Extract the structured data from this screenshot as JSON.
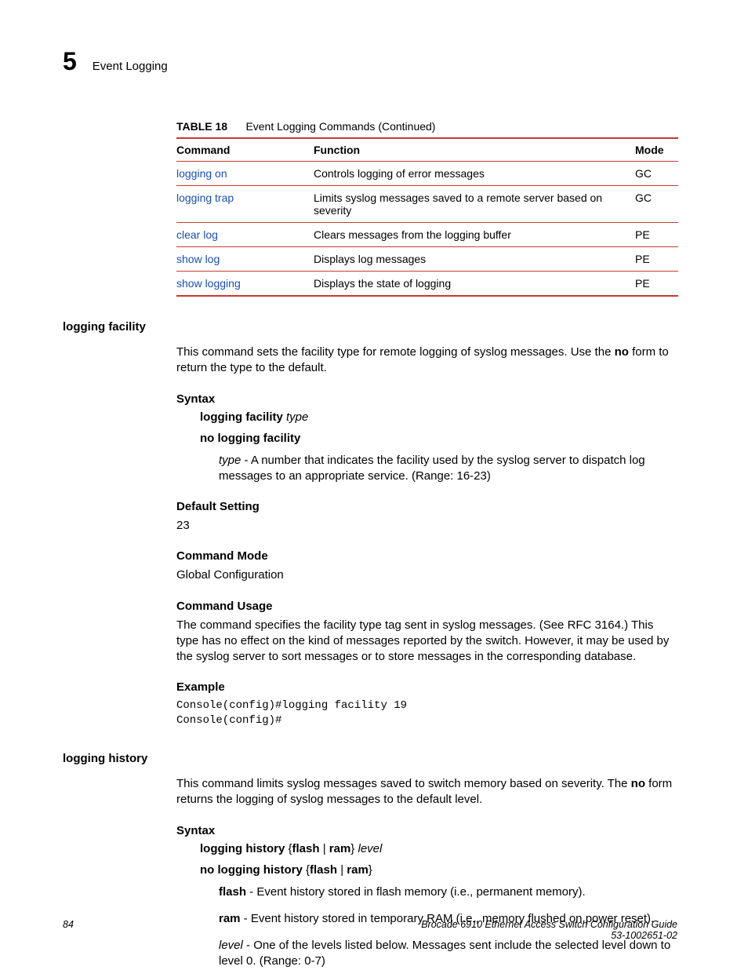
{
  "header": {
    "chapter_number": "5",
    "chapter_title": "Event Logging"
  },
  "table": {
    "label": "TABLE 18",
    "caption": "Event Logging Commands  (Continued)",
    "headers": {
      "c1": "Command",
      "c2": "Function",
      "c3": "Mode"
    },
    "rows": [
      {
        "cmd": "logging on",
        "func": "Controls logging of error messages",
        "mode": "GC"
      },
      {
        "cmd": "logging trap",
        "func": "Limits syslog messages saved to a remote server based on severity",
        "mode": "GC"
      },
      {
        "cmd": "clear log",
        "func": "Clears messages from the logging buffer",
        "mode": "PE"
      },
      {
        "cmd": "show log",
        "func": "Displays log messages",
        "mode": "PE"
      },
      {
        "cmd": "show logging",
        "func": "Displays the state of logging",
        "mode": "PE"
      }
    ]
  },
  "sec1": {
    "title": "logging facility",
    "intro_pre": "This command sets the facility type for remote logging of syslog messages. Use the ",
    "intro_bold": "no",
    "intro_post": " form to return the type to the default.",
    "syntax_hdr": "Syntax",
    "syn1_bold": "logging facility ",
    "syn1_it": "type",
    "syn2_bold": "no logging facility",
    "param_it": "type",
    "param_txt": " - A number that indicates the facility used by the syslog server to dispatch log messages to an appropriate service. (Range: 16-23)",
    "default_hdr": "Default Setting",
    "default_val": "23",
    "mode_hdr": "Command Mode",
    "mode_val": "Global Configuration",
    "usage_hdr": "Command Usage",
    "usage_txt": "The command specifies the facility type tag sent in syslog messages. (See RFC 3164.) This type has no effect on the kind of messages reported by the switch. However, it may be used by the syslog server to sort messages or to store messages in the corresponding database.",
    "example_hdr": "Example",
    "example_code": "Console(config)#logging facility 19\nConsole(config)#"
  },
  "sec2": {
    "title": "logging history",
    "intro_pre": "This command limits syslog messages saved to switch memory based on severity. The ",
    "intro_bold": "no",
    "intro_post": " form returns the logging of syslog messages to the default level.",
    "syntax_hdr": "Syntax",
    "syn1_b1": "logging history",
    "syn1_mid": " {",
    "syn1_b2": "flash",
    "syn1_sep": " | ",
    "syn1_b3": "ram",
    "syn1_close": "} ",
    "syn1_it": "level",
    "syn2_b1": "no logging history",
    "syn2_mid": " {",
    "syn2_b2": "flash",
    "syn2_sep": " | ",
    "syn2_b3": "ram",
    "syn2_close": "}",
    "p1_b": "flash",
    "p1_txt": " - Event history stored in flash memory (i.e., permanent memory).",
    "p2_b": "ram",
    "p2_txt": " - Event history stored in temporary RAM (i.e., memory flushed on power reset).",
    "p3_it": "level",
    "p3_txt": " - One of the levels listed below. Messages sent include the selected level down to level 0. (Range: 0-7)"
  },
  "footer": {
    "page": "84",
    "book": "Brocade 6910 Ethernet Access Switch Configuration Guide",
    "docnum": "53-1002651-02"
  }
}
